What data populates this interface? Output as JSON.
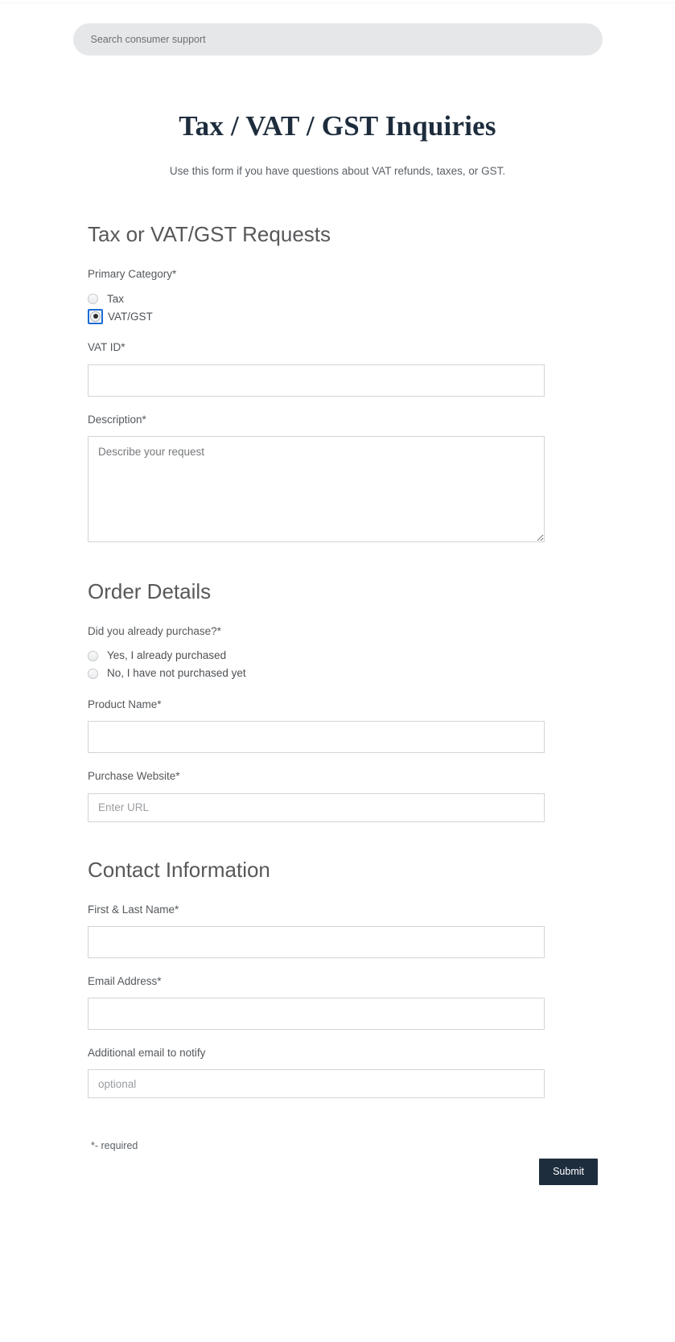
{
  "search": {
    "placeholder": "Search consumer support",
    "value": ""
  },
  "hero": {
    "title": "Tax / VAT / GST Inquiries",
    "subtitle": "Use this form if you have questions about VAT refunds, taxes, or GST."
  },
  "sections": {
    "tax": {
      "title": "Tax or VAT/GST Requests",
      "primary_category": {
        "label": "Primary Category*",
        "options": [
          {
            "label": "Tax",
            "checked": false
          },
          {
            "label": "VAT/GST",
            "checked": true
          }
        ]
      },
      "vat_id": {
        "label": "VAT ID*",
        "value": "",
        "placeholder": ""
      },
      "description": {
        "label": "Description*",
        "value": "",
        "placeholder": "Describe your request"
      }
    },
    "order": {
      "title": "Order Details",
      "already_purchased": {
        "label": "Did you already purchase?*",
        "options": [
          {
            "label": "Yes, I already purchased",
            "checked": false
          },
          {
            "label": "No, I have not purchased yet",
            "checked": false
          }
        ]
      },
      "product_name": {
        "label": "Product Name*",
        "value": "",
        "placeholder": ""
      },
      "purchase_website": {
        "label": "Purchase Website*",
        "value": "",
        "placeholder": "Enter URL"
      }
    },
    "contact": {
      "title": "Contact Information",
      "full_name": {
        "label": "First & Last Name*",
        "value": "",
        "placeholder": ""
      },
      "email": {
        "label": "Email Address*",
        "value": "",
        "placeholder": ""
      },
      "additional_email": {
        "label": "Additional email to notify",
        "value": "",
        "placeholder": "optional"
      }
    }
  },
  "footer": {
    "required_note": "*- required",
    "submit_label": "Submit"
  },
  "colors": {
    "accent_dark": "#1e2d3d",
    "search_bg": "#e6e7e8",
    "focus_ring": "#1b6bd6",
    "border": "#d2d4d6"
  }
}
